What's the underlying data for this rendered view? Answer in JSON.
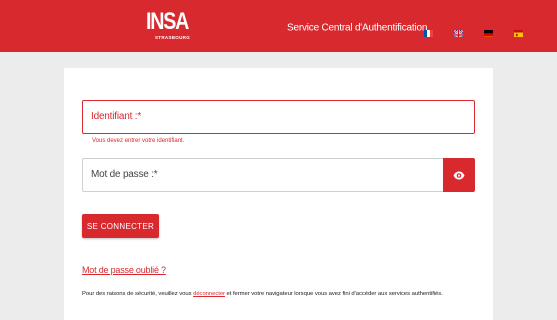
{
  "header": {
    "logo_text": "INSA",
    "logo_subtext": "STRASBOURG",
    "service_title": "Service Central d'Authentification",
    "languages": [
      "fr",
      "en",
      "de",
      "es"
    ]
  },
  "form": {
    "username_label": "Identifiant :*",
    "username_error": "Vous devez entrer votre identifiant.",
    "password_label": "Mot de passe :*",
    "submit_label": "SE CONNECTER",
    "forgot_password": "Mot de passe oublié ?"
  },
  "security": {
    "text_before": "Pour des raisons de sécurité, veuillez vous ",
    "link": "déconnecter",
    "text_after": " et fermer votre navigateur lorsque vous avez fini d'accéder aux services authentifiés."
  },
  "colors": {
    "brand_red": "#d8292f",
    "background": "#ececec",
    "card": "#ffffff"
  },
  "icons": {
    "password_toggle": "eye-icon"
  }
}
